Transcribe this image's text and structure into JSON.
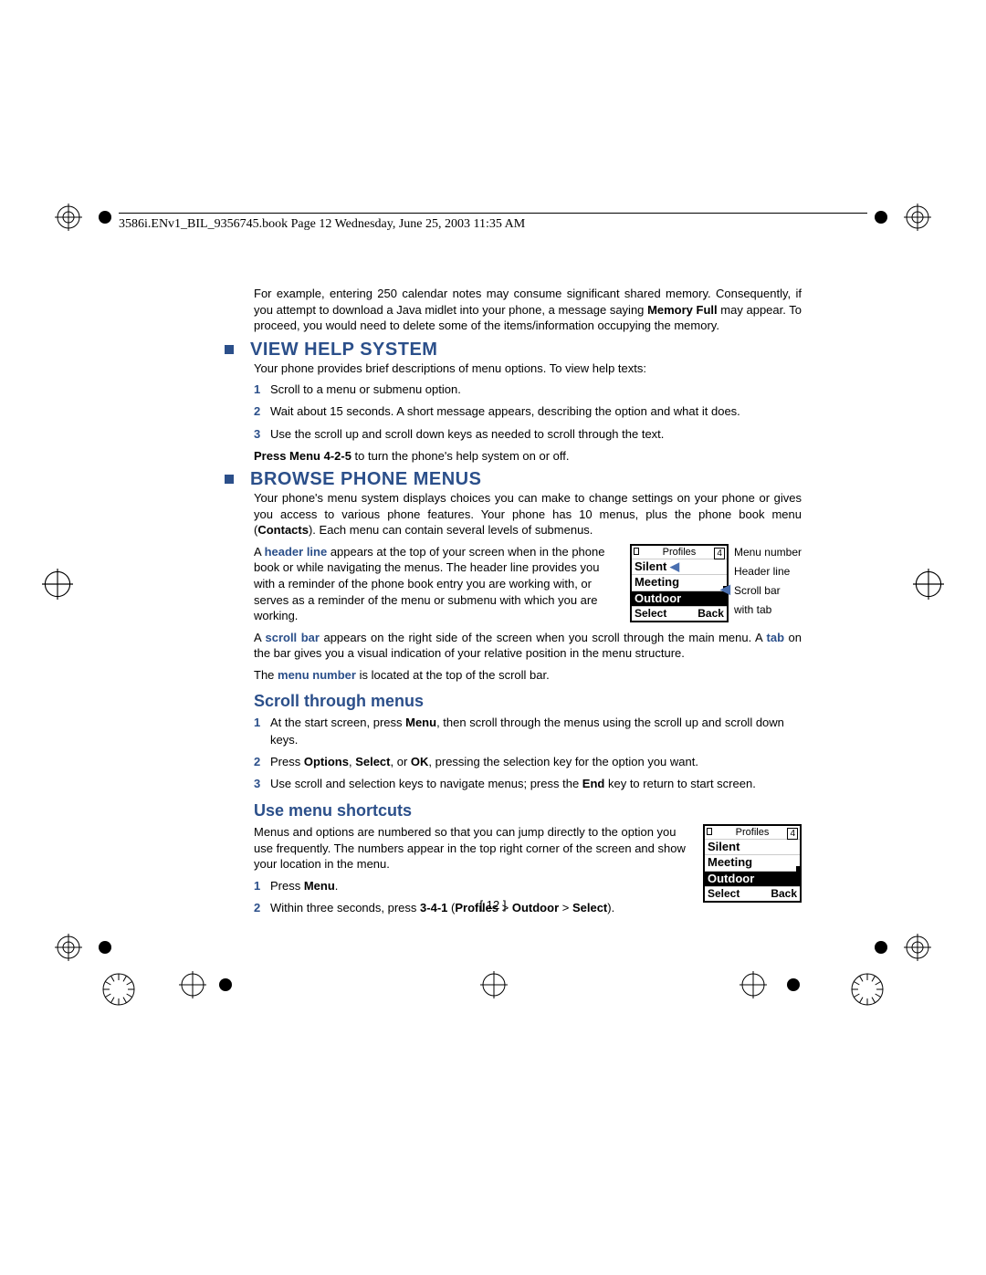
{
  "header": "3586i.ENv1_BIL_9356745.book  Page 12  Wednesday, June 25, 2003  11:35 AM",
  "intro_para": {
    "part1": "For example, entering 250 calendar notes may consume significant shared memory. Consequently, if you attempt to download a Java midlet into your phone, a message saying ",
    "bold1": "Memory Full",
    "part2": " may appear. To proceed, you would need to delete some of the items/information occupying the memory."
  },
  "section1": {
    "title": "VIEW HELP SYSTEM",
    "intro": "Your phone provides brief descriptions of menu options. To view help texts:",
    "steps": [
      "Scroll to a menu or submenu option.",
      "Wait about 15 seconds. A short message appears, describing the option and what it does.",
      "Use the scroll up and scroll down keys as needed to scroll through the text."
    ],
    "footer_bold": "Press Menu 4-2-5",
    "footer_rest": " to turn the phone's help system on or off."
  },
  "section2": {
    "title": "BROWSE PHONE MENUS",
    "intro": {
      "part1": "Your phone's menu system displays choices you can make to change settings on your phone or gives you access to various phone features. Your phone has 10 menus, plus the phone book menu (",
      "bold1": "Contacts",
      "part2": "). Each menu can contain several levels of submenus."
    },
    "para_headerline": {
      "part1": "A ",
      "blue1": "header line",
      "part2": " appears at the top of your screen when in the phone book or while navigating the menus. The header line provides you with a reminder of the phone book entry you are working with, or serves as a reminder of the menu or submenu with which you are working."
    },
    "para_scrollbar": {
      "part1": "A ",
      "blue1": "scroll bar",
      "part2": " appears on the right side of the screen when you scroll through the main menu. A ",
      "blue2": "tab",
      "part3": " on the bar gives you a visual indication of your relative position in the menu structure."
    },
    "para_menunum": {
      "part1": "The ",
      "blue1": "menu number",
      "part2": " is located at the top of the scroll bar."
    },
    "fig1_labels": {
      "l1": "Menu number",
      "l2": "Header line",
      "l3": "Scroll bar",
      "l4": "with tab"
    }
  },
  "section3": {
    "title": "Scroll through menus",
    "steps": [
      {
        "pre": "At the start screen, press ",
        "b1": "Menu",
        "post": ", then scroll through the menus using the scroll up and scroll down keys."
      },
      {
        "pre": "Press ",
        "b1": "Options",
        "mid1": ", ",
        "b2": "Select",
        "mid2": ", or ",
        "b3": "OK",
        "post": ", pressing the selection key for the option you want."
      },
      {
        "pre": "Use scroll and selection keys to navigate menus; press the ",
        "b1": "End",
        "post": " key to return to start screen."
      }
    ]
  },
  "section4": {
    "title": "Use menu shortcuts",
    "intro": "Menus and options are numbered so that you can jump directly to the option you use frequently. The numbers appear in the top right corner of the screen and show your location in the menu.",
    "steps": [
      {
        "pre": "Press ",
        "b1": "Menu",
        "post": "."
      },
      {
        "pre": "Within three seconds, press ",
        "b1": "3-4-1",
        "mid1": " (",
        "b2": "Profiles",
        "mid2": " > ",
        "b3": "Outdoor",
        "mid3": " > ",
        "b4": "Select",
        "post": ")."
      }
    ]
  },
  "phone_screen": {
    "header_label": "Profiles",
    "menu_num": "4",
    "rows": [
      "Silent",
      "Meeting",
      "Outdoor"
    ],
    "selected_index": 2,
    "left_soft": "Select",
    "right_soft": "Back"
  },
  "page_number": "[ 12 ]"
}
